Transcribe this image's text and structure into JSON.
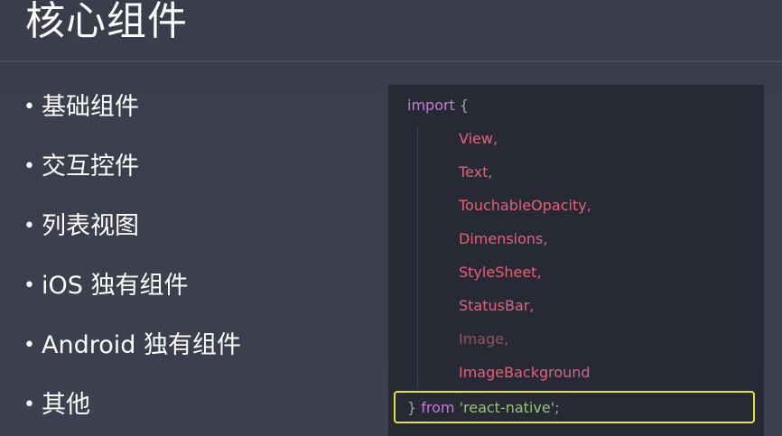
{
  "slide": {
    "title": "核心组件",
    "bullet_symbol": "•",
    "bullets": [
      "基础组件",
      "交互控件",
      "列表视图",
      "iOS 独有组件",
      "Android 独有组件",
      "其他"
    ]
  },
  "code": {
    "import_keyword": "import",
    "open_brace": "{",
    "items": [
      "View,",
      "Text,",
      "TouchableOpacity,",
      "Dimensions,",
      "StyleSheet,",
      "StatusBar,",
      "Image,",
      "ImageBackground"
    ],
    "close_brace": "}",
    "from_keyword": "from",
    "module": "'react-native'",
    "semicolon": ";"
  },
  "colors": {
    "background": "#3c3f4e",
    "code_background": "#272a35",
    "keyword": "#c678dd",
    "identifier": "#e0637a",
    "string": "#98c379",
    "highlight": "#e6e235"
  }
}
